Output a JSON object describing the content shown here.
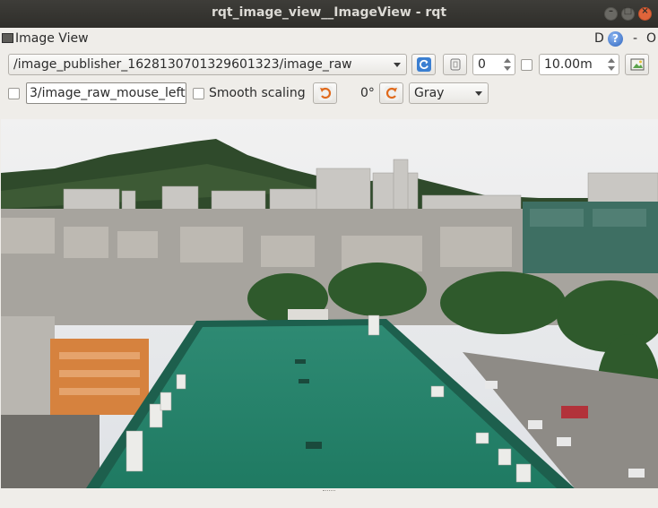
{
  "window": {
    "title": "rqt_image_view__ImageView - rqt"
  },
  "plugin": {
    "title": "Image View",
    "header_d": "D",
    "header_help": "?",
    "header_dash": "-",
    "header_o": "O"
  },
  "toolbar": {
    "topic": "/image_publisher_1628130701329601323/image_raw",
    "refresh_icon": "refresh-icon",
    "zoom_icon": "fit-zoom-icon",
    "spin_value": "0",
    "timeout_value": "10.00m",
    "save_icon": "save-image-icon"
  },
  "toolbar2": {
    "mouse_topic": "3/image_raw_mouse_left",
    "smooth_label": "Smooth scaling",
    "rotate_left_icon": "rotate-left-icon",
    "rotation": "0°",
    "rotate_right_icon": "rotate-right-icon",
    "color_scheme": "Gray"
  },
  "image": {
    "description_icon": "camera-image"
  },
  "colors": {
    "accent": "#2f66bf",
    "close": "#e0643a"
  }
}
